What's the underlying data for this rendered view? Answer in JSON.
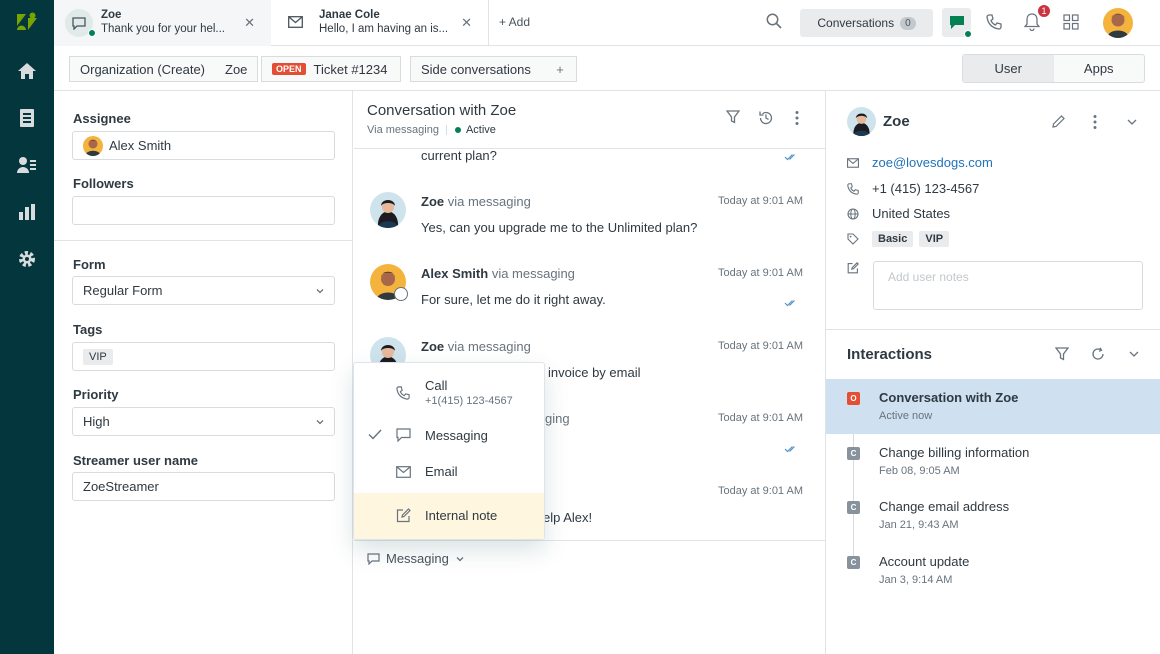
{
  "colors": {
    "nav_bg": "#03363d",
    "accent_green": "#038153",
    "open_badge": "#e34f32",
    "selected_interaction": "#cfe0f1",
    "menu_highlight": "#fff6e0",
    "notification": "#cc3340"
  },
  "nav": {
    "items": [
      "home-icon",
      "views-icon",
      "customers-icon",
      "reporting-icon",
      "admin-icon"
    ]
  },
  "tabs": [
    {
      "title": "Zoe",
      "subtitle": "Thank you for your hel...",
      "icon": "chat-icon"
    },
    {
      "title": "Janae Cole",
      "subtitle": "Hello, I am having an is...",
      "icon": "mail-icon"
    }
  ],
  "topbar": {
    "add_label": "+ Add",
    "conversations_label": "Conversations",
    "conversations_count": "0",
    "notification_count": "1"
  },
  "breadcrumb": {
    "org": "Organization (Create)",
    "user": "Zoe",
    "status": "OPEN",
    "ticket": "Ticket #1234",
    "side": "Side conversations",
    "add": "+"
  },
  "panel_toggle": {
    "user": "User",
    "apps": "Apps"
  },
  "properties": {
    "assignee_label": "Assignee",
    "assignee_value": "Alex Smith",
    "followers_label": "Followers",
    "followers_value": "",
    "form_label": "Form",
    "form_value": "Regular Form",
    "tags_label": "Tags",
    "tags": [
      "VIP"
    ],
    "priority_label": "Priority",
    "priority_value": "High",
    "streamer_label": "Streamer user name",
    "streamer_value": "ZoeStreamer"
  },
  "conversation": {
    "title": "Conversation with Zoe",
    "via": "Via messaging",
    "status": "Active",
    "truncated_text": "current plan?",
    "messages": [
      {
        "name": "Zoe",
        "via": "via messaging",
        "time": "Today at 9:01 AM",
        "text": "Yes, can you upgrade me to the Unlimited plan?"
      },
      {
        "name": "Alex Smith",
        "via": "via messaging",
        "time": "Today at 9:01 AM",
        "text": "For sure, let me do it right away."
      },
      {
        "name": "Zoe",
        "via": "via messaging",
        "time": "Today at 9:01 AM",
        "text": "invoice by email"
      },
      {
        "name": "",
        "via": "ging",
        "time": "Today at 9:01 AM",
        "text": ""
      },
      {
        "name": "",
        "via": "",
        "time": "Today at 9:01 AM",
        "text": "elp Alex!"
      }
    ],
    "channel": "Messaging"
  },
  "channel_menu": {
    "call_label": "Call",
    "call_number": "+1(415) 123-4567",
    "messaging_label": "Messaging",
    "email_label": "Email",
    "note_label": "Internal note"
  },
  "user": {
    "name": "Zoe",
    "email": "zoe@lovesdogs.com",
    "phone": "+1 (415) 123-4567",
    "country": "United States",
    "tags": [
      "Basic",
      "VIP"
    ],
    "notes_placeholder": "Add user notes"
  },
  "interactions": {
    "title": "Interactions",
    "items": [
      {
        "badge": "O",
        "title": "Conversation with Zoe",
        "subtitle": "Active now"
      },
      {
        "badge": "C",
        "title": "Change billing information",
        "subtitle": "Feb 08, 9:05 AM"
      },
      {
        "badge": "C",
        "title": "Change email address",
        "subtitle": "Jan 21, 9:43 AM"
      },
      {
        "badge": "C",
        "title": "Account update",
        "subtitle": "Jan 3, 9:14 AM"
      }
    ]
  }
}
